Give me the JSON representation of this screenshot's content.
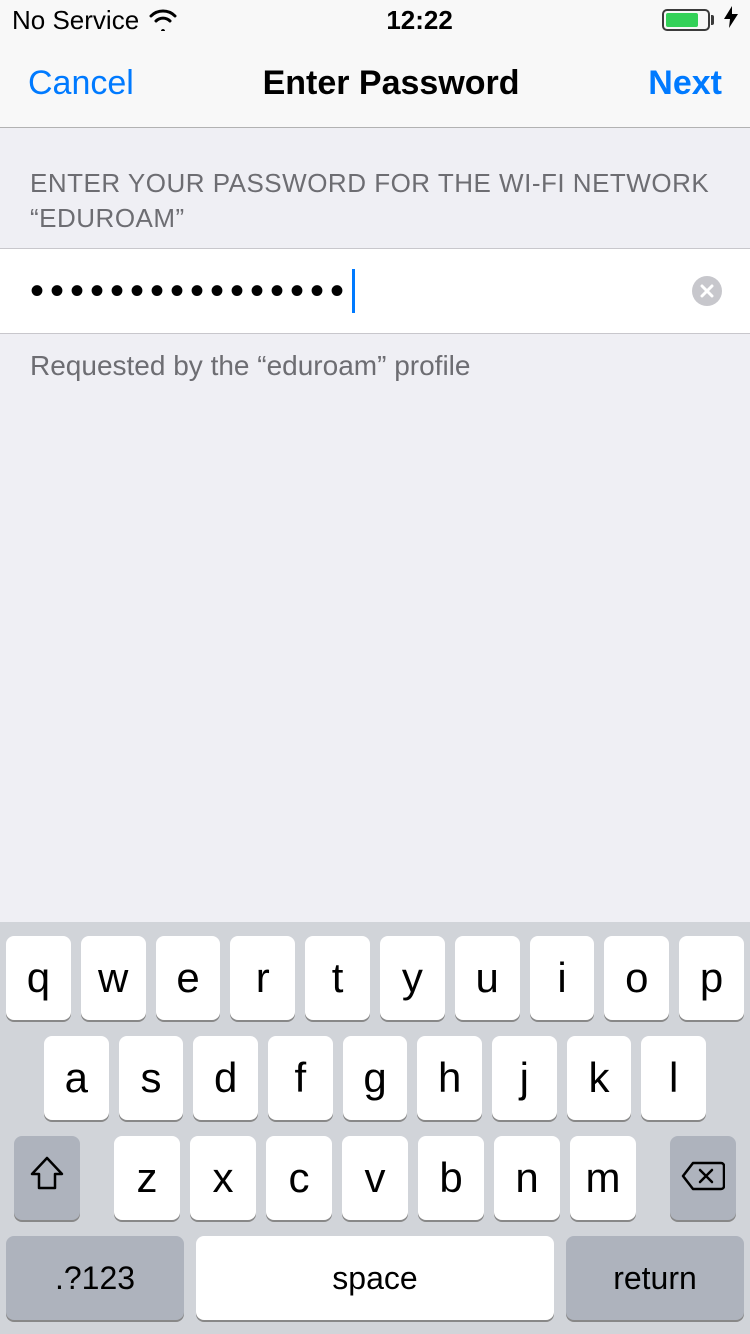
{
  "status": {
    "carrier": "No Service",
    "time": "12:22"
  },
  "nav": {
    "cancel": "Cancel",
    "title": "Enter Password",
    "next": "Next"
  },
  "section": {
    "header_line1": "ENTER YOUR PASSWORD FOR THE WI-FI NETWORK",
    "header_line2": "“EDUROAM”"
  },
  "input": {
    "masked_value": "••••••••••••••••"
  },
  "footer": {
    "note": "Requested by the “eduroam” profile"
  },
  "keyboard": {
    "row1": [
      "q",
      "w",
      "e",
      "r",
      "t",
      "y",
      "u",
      "i",
      "o",
      "p"
    ],
    "row2": [
      "a",
      "s",
      "d",
      "f",
      "g",
      "h",
      "j",
      "k",
      "l"
    ],
    "row3": [
      "z",
      "x",
      "c",
      "v",
      "b",
      "n",
      "m"
    ],
    "special": ".?123",
    "space": "space",
    "return": "return"
  }
}
